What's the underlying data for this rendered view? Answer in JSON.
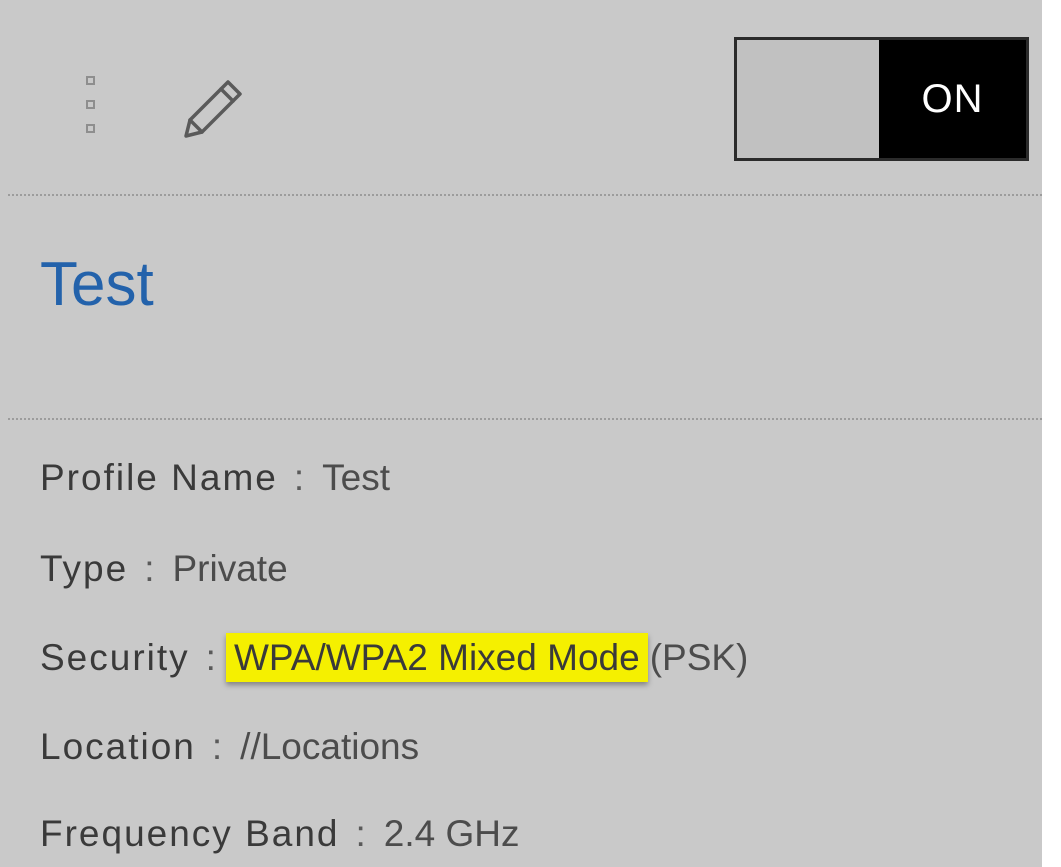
{
  "header": {
    "drag_icon": "drag-handle-icon",
    "edit_icon": "pencil-icon",
    "toggle_label": "ON"
  },
  "profile": {
    "title": "Test",
    "fields": [
      {
        "label": "Profile Name",
        "separator": ":",
        "value": "Test"
      },
      {
        "label": "Type",
        "separator": ":",
        "value": "Private"
      },
      {
        "label": "Security",
        "separator": ":",
        "value_highlighted": "WPA/WPA2 Mixed Mode",
        "value_suffix": "(PSK)"
      },
      {
        "label": "Location",
        "separator": ":",
        "value": "//Locations"
      },
      {
        "label": "Frequency Band",
        "separator": ":",
        "value": "2.4 GHz"
      }
    ]
  },
  "colors": {
    "card_background": "#c9c9c9",
    "title": "#2362ab",
    "highlight": "#f5f000",
    "toggle_on": "#000000"
  }
}
